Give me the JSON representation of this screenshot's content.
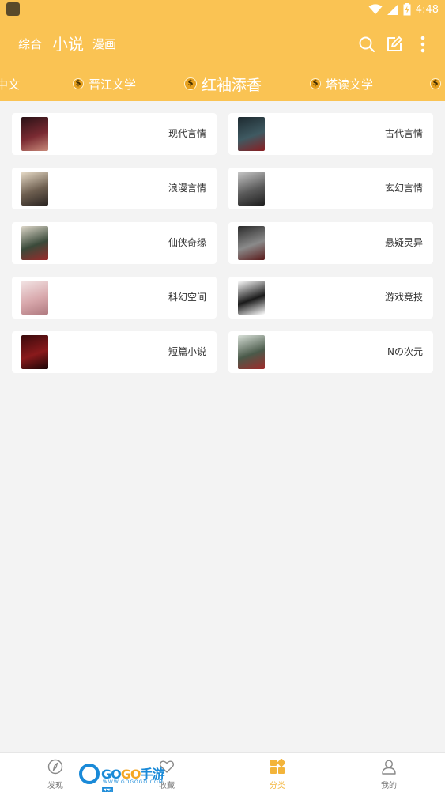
{
  "status_bar": {
    "time": "4:48"
  },
  "nav": {
    "tabs": [
      {
        "label": "综合",
        "active": false
      },
      {
        "label": "小说",
        "active": true
      },
      {
        "label": "漫画",
        "active": false
      }
    ],
    "icons": [
      "search-icon",
      "edit-icon",
      "more-vertical-icon"
    ]
  },
  "sources": [
    {
      "label": "中文",
      "active": false
    },
    {
      "label": "晋江文学",
      "active": false
    },
    {
      "label": "红袖添香",
      "active": true
    },
    {
      "label": "塔读文学",
      "active": false
    }
  ],
  "categories": [
    {
      "label": "现代言情",
      "thumb": [
        "#2a1216",
        "#7a2a32",
        "#c98a7a"
      ]
    },
    {
      "label": "古代言情",
      "thumb": [
        "#1d2a30",
        "#3f5a62",
        "#8a1e22"
      ]
    },
    {
      "label": "浪漫言情",
      "thumb": [
        "#e8dcc8",
        "#6e5f50",
        "#2b2522"
      ]
    },
    {
      "label": "玄幻言情",
      "thumb": [
        "#c8c8c8",
        "#5a5a5a",
        "#1e1e1e"
      ]
    },
    {
      "label": "仙侠奇缘",
      "thumb": [
        "#dcd6c8",
        "#3a4a3a",
        "#9a2a2a"
      ]
    },
    {
      "label": "悬疑灵异",
      "thumb": [
        "#2a2a2a",
        "#8a8a8a",
        "#5a1a1a"
      ]
    },
    {
      "label": "科幻空间",
      "thumb": [
        "#f2e4e4",
        "#d8a8ac",
        "#b07a80"
      ]
    },
    {
      "label": "游戏竞技",
      "thumb": [
        "#ffffff",
        "#1a1a1a",
        "#ffffff"
      ]
    },
    {
      "label": "短篇小说",
      "thumb": [
        "#3a0a0c",
        "#8a1a1c",
        "#1a0506"
      ]
    },
    {
      "label": "Nの次元",
      "thumb": [
        "#d8e0d8",
        "#4a5a4a",
        "#a02a2a"
      ]
    }
  ],
  "bottom_nav": [
    {
      "label": "发现",
      "icon": "compass-icon",
      "active": false
    },
    {
      "label": "收藏",
      "icon": "heart-icon",
      "active": false
    },
    {
      "label": "分类",
      "icon": "category-grid-icon",
      "active": true
    },
    {
      "label": "我的",
      "icon": "user-icon",
      "active": false
    }
  ],
  "watermark": {
    "brand_a": "GO",
    "brand_b": "GO",
    "brand_cn": "手游网",
    "url": "WWW.GOGOGO.COM"
  },
  "colors": {
    "accent": "#fac353",
    "active_tab": "#f3b43a",
    "background": "#f3f3f3"
  }
}
